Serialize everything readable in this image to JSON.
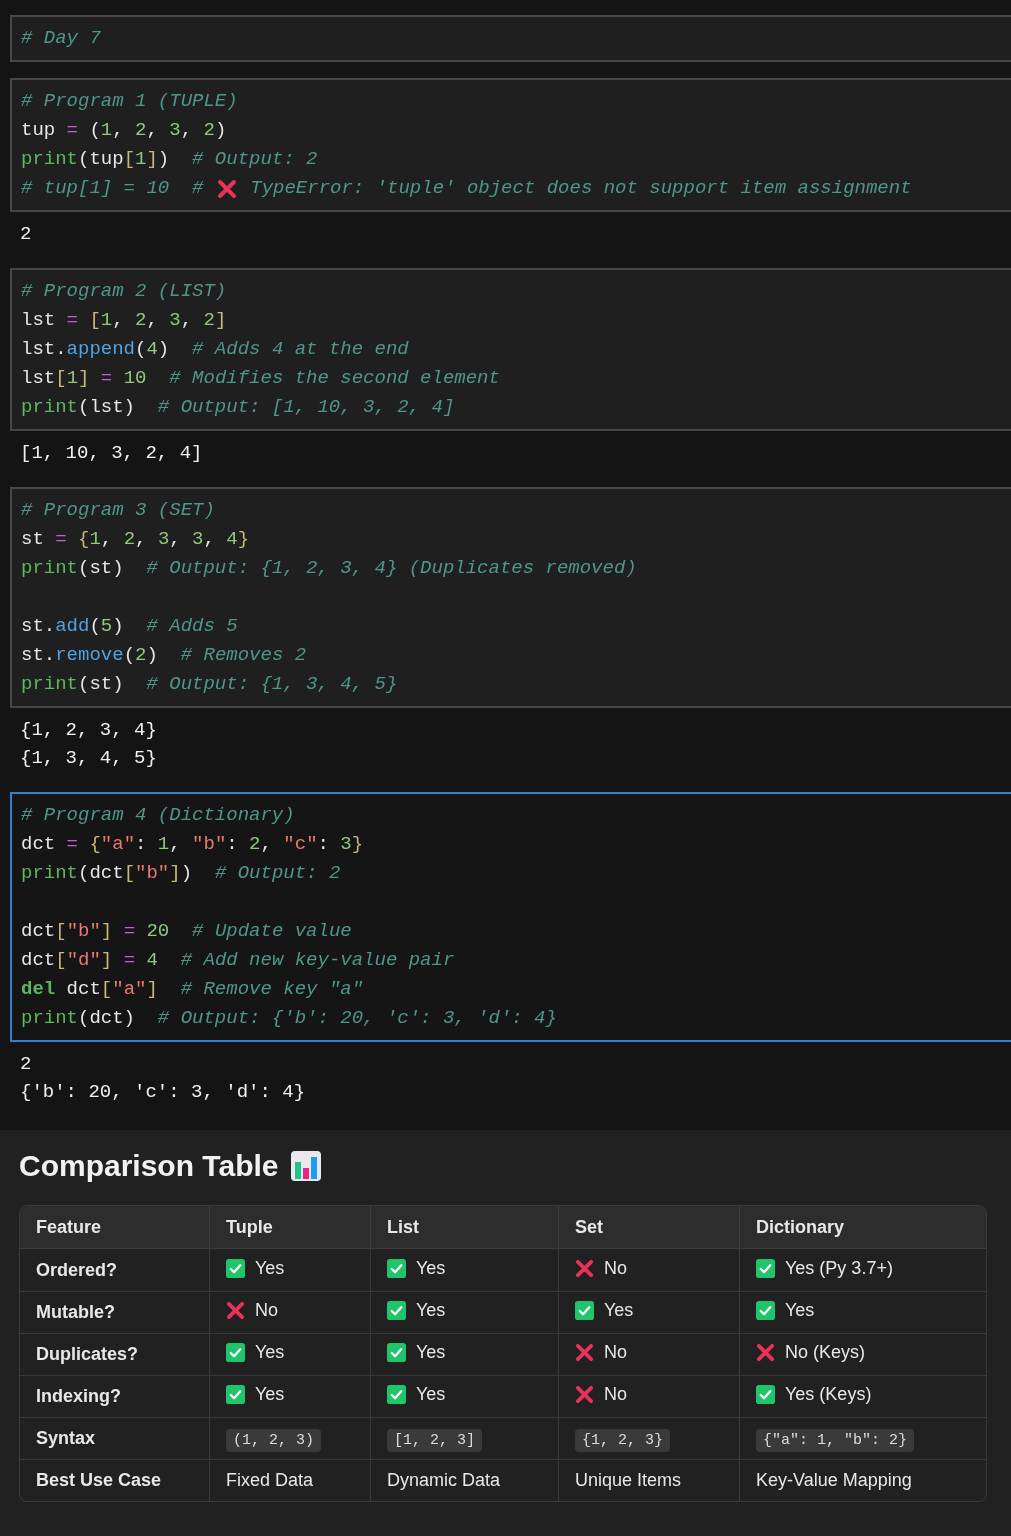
{
  "notebook": {
    "cells": [
      {
        "selected": false,
        "lines": [
          {
            "kind": "code",
            "tokens": [
              {
                "kind": "comment",
                "text": "# Day 7"
              }
            ]
          }
        ]
      },
      {
        "selected": false,
        "lines": [
          {
            "kind": "code",
            "tokens": [
              {
                "kind": "comment",
                "text": "# Program 1 (TUPLE)"
              }
            ]
          },
          {
            "kind": "code",
            "tokens": [
              {
                "kind": "var",
                "text": "tup "
              },
              {
                "kind": "op",
                "text": "="
              },
              {
                "kind": "punct",
                "text": " ("
              },
              {
                "kind": "num",
                "text": "1"
              },
              {
                "kind": "punct",
                "text": ", "
              },
              {
                "kind": "num",
                "text": "2"
              },
              {
                "kind": "punct",
                "text": ", "
              },
              {
                "kind": "num",
                "text": "3"
              },
              {
                "kind": "punct",
                "text": ", "
              },
              {
                "kind": "num",
                "text": "2"
              },
              {
                "kind": "punct",
                "text": ")"
              }
            ]
          },
          {
            "kind": "code",
            "tokens": [
              {
                "kind": "func",
                "text": "print"
              },
              {
                "kind": "punct",
                "text": "(tup"
              },
              {
                "kind": "bracket",
                "text": "["
              },
              {
                "kind": "num",
                "text": "1"
              },
              {
                "kind": "bracket",
                "text": "]"
              },
              {
                "kind": "punct",
                "text": ")  "
              },
              {
                "kind": "comment",
                "text": "# Output: 2"
              }
            ]
          },
          {
            "kind": "code",
            "tokens": [
              {
                "kind": "comment",
                "text": "# tup[1] = 10  # "
              },
              {
                "kind": "cross"
              },
              {
                "kind": "comment",
                "text": " TypeError: 'tuple' object does not support item assignment"
              }
            ]
          }
        ],
        "outputs": [
          "2"
        ]
      },
      {
        "selected": false,
        "lines": [
          {
            "kind": "code",
            "tokens": [
              {
                "kind": "comment",
                "text": "# Program 2 (LIST)"
              }
            ]
          },
          {
            "kind": "code",
            "tokens": [
              {
                "kind": "var",
                "text": "lst "
              },
              {
                "kind": "op",
                "text": "= "
              },
              {
                "kind": "bracket",
                "text": "["
              },
              {
                "kind": "num",
                "text": "1"
              },
              {
                "kind": "punct",
                "text": ", "
              },
              {
                "kind": "num",
                "text": "2"
              },
              {
                "kind": "punct",
                "text": ", "
              },
              {
                "kind": "num",
                "text": "3"
              },
              {
                "kind": "punct",
                "text": ", "
              },
              {
                "kind": "num",
                "text": "2"
              },
              {
                "kind": "bracket",
                "text": "]"
              }
            ]
          },
          {
            "kind": "code",
            "tokens": [
              {
                "kind": "var",
                "text": "lst."
              },
              {
                "kind": "method",
                "text": "append"
              },
              {
                "kind": "punct",
                "text": "("
              },
              {
                "kind": "num",
                "text": "4"
              },
              {
                "kind": "punct",
                "text": ")  "
              },
              {
                "kind": "comment",
                "text": "# Adds 4 at the end"
              }
            ]
          },
          {
            "kind": "code",
            "tokens": [
              {
                "kind": "var",
                "text": "lst"
              },
              {
                "kind": "bracket",
                "text": "["
              },
              {
                "kind": "num",
                "text": "1"
              },
              {
                "kind": "bracket",
                "text": "]"
              },
              {
                "kind": "op",
                "text": " = "
              },
              {
                "kind": "num",
                "text": "10"
              },
              {
                "kind": "comment",
                "text": "  # Modifies the second element"
              }
            ]
          },
          {
            "kind": "code",
            "tokens": [
              {
                "kind": "func",
                "text": "print"
              },
              {
                "kind": "punct",
                "text": "(lst)  "
              },
              {
                "kind": "comment",
                "text": "# Output: [1, 10, 3, 2, 4]"
              }
            ]
          }
        ],
        "outputs": [
          "[1, 10, 3, 2, 4]"
        ]
      },
      {
        "selected": false,
        "lines": [
          {
            "kind": "code",
            "tokens": [
              {
                "kind": "comment",
                "text": "# Program 3 (SET)"
              }
            ]
          },
          {
            "kind": "code",
            "tokens": [
              {
                "kind": "var",
                "text": "st "
              },
              {
                "kind": "op",
                "text": "= "
              },
              {
                "kind": "bracket",
                "text": "{"
              },
              {
                "kind": "num",
                "text": "1"
              },
              {
                "kind": "punct",
                "text": ", "
              },
              {
                "kind": "num",
                "text": "2"
              },
              {
                "kind": "punct",
                "text": ", "
              },
              {
                "kind": "num",
                "text": "3"
              },
              {
                "kind": "punct",
                "text": ", "
              },
              {
                "kind": "num",
                "text": "3"
              },
              {
                "kind": "punct",
                "text": ", "
              },
              {
                "kind": "num",
                "text": "4"
              },
              {
                "kind": "bracket",
                "text": "}"
              }
            ]
          },
          {
            "kind": "code",
            "tokens": [
              {
                "kind": "func",
                "text": "print"
              },
              {
                "kind": "punct",
                "text": "(st)  "
              },
              {
                "kind": "comment",
                "text": "# Output: {1, 2, 3, 4} (Duplicates removed)"
              }
            ]
          },
          {
            "kind": "blank"
          },
          {
            "kind": "code",
            "tokens": [
              {
                "kind": "var",
                "text": "st."
              },
              {
                "kind": "method",
                "text": "add"
              },
              {
                "kind": "punct",
                "text": "("
              },
              {
                "kind": "num",
                "text": "5"
              },
              {
                "kind": "punct",
                "text": ")  "
              },
              {
                "kind": "comment",
                "text": "# Adds 5"
              }
            ]
          },
          {
            "kind": "code",
            "tokens": [
              {
                "kind": "var",
                "text": "st."
              },
              {
                "kind": "method",
                "text": "remove"
              },
              {
                "kind": "punct",
                "text": "("
              },
              {
                "kind": "num",
                "text": "2"
              },
              {
                "kind": "punct",
                "text": ")  "
              },
              {
                "kind": "comment",
                "text": "# Removes 2"
              }
            ]
          },
          {
            "kind": "code",
            "tokens": [
              {
                "kind": "func",
                "text": "print"
              },
              {
                "kind": "punct",
                "text": "(st)  "
              },
              {
                "kind": "comment",
                "text": "# Output: {1, 3, 4, 5}"
              }
            ]
          }
        ],
        "outputs": [
          "{1, 2, 3, 4}",
          "{1, 3, 4, 5}"
        ]
      },
      {
        "selected": true,
        "lines": [
          {
            "kind": "code",
            "tokens": [
              {
                "kind": "comment",
                "text": "# Program 4 (Dictionary)"
              }
            ]
          },
          {
            "kind": "code",
            "tokens": [
              {
                "kind": "var",
                "text": "dct "
              },
              {
                "kind": "op",
                "text": "= "
              },
              {
                "kind": "bracket",
                "text": "{"
              },
              {
                "kind": "str",
                "text": "\"a\""
              },
              {
                "kind": "punct",
                "text": ": "
              },
              {
                "kind": "num",
                "text": "1"
              },
              {
                "kind": "punct",
                "text": ", "
              },
              {
                "kind": "str",
                "text": "\"b\""
              },
              {
                "kind": "punct",
                "text": ": "
              },
              {
                "kind": "num",
                "text": "2"
              },
              {
                "kind": "punct",
                "text": ", "
              },
              {
                "kind": "str",
                "text": "\"c\""
              },
              {
                "kind": "punct",
                "text": ": "
              },
              {
                "kind": "num",
                "text": "3"
              },
              {
                "kind": "bracket",
                "text": "}"
              }
            ]
          },
          {
            "kind": "code",
            "tokens": [
              {
                "kind": "func",
                "text": "print"
              },
              {
                "kind": "punct",
                "text": "(dct"
              },
              {
                "kind": "bracket",
                "text": "["
              },
              {
                "kind": "str",
                "text": "\"b\""
              },
              {
                "kind": "bracket",
                "text": "]"
              },
              {
                "kind": "punct",
                "text": ")  "
              },
              {
                "kind": "comment",
                "text": "# Output: 2"
              }
            ]
          },
          {
            "kind": "blank"
          },
          {
            "kind": "code",
            "tokens": [
              {
                "kind": "var",
                "text": "dct"
              },
              {
                "kind": "bracket",
                "text": "["
              },
              {
                "kind": "str",
                "text": "\"b\""
              },
              {
                "kind": "bracket",
                "text": "]"
              },
              {
                "kind": "op",
                "text": " = "
              },
              {
                "kind": "num",
                "text": "20"
              },
              {
                "kind": "comment",
                "text": "  # Update value"
              }
            ]
          },
          {
            "kind": "code",
            "tokens": [
              {
                "kind": "var",
                "text": "dct"
              },
              {
                "kind": "bracket",
                "text": "["
              },
              {
                "kind": "str",
                "text": "\"d\""
              },
              {
                "kind": "bracket",
                "text": "]"
              },
              {
                "kind": "op",
                "text": " = "
              },
              {
                "kind": "num",
                "text": "4"
              },
              {
                "kind": "comment",
                "text": "  # Add new key-value pair"
              }
            ]
          },
          {
            "kind": "code",
            "tokens": [
              {
                "kind": "keyword",
                "text": "del"
              },
              {
                "kind": "punct",
                "text": " dct"
              },
              {
                "kind": "bracket",
                "text": "["
              },
              {
                "kind": "str",
                "text": "\"a\""
              },
              {
                "kind": "bracket",
                "text": "]"
              },
              {
                "kind": "comment",
                "text": "  # Remove key \"a\""
              }
            ]
          },
          {
            "kind": "code",
            "tokens": [
              {
                "kind": "func",
                "text": "print"
              },
              {
                "kind": "punct",
                "text": "(dct)  "
              },
              {
                "kind": "comment",
                "text": "# Output: {'b': 20, 'c': 3, 'd': 4}"
              }
            ]
          }
        ],
        "outputs": [
          "2",
          "{'b': 20, 'c': 3, 'd': 4}"
        ]
      }
    ]
  },
  "comparison": {
    "title": "Comparison Table",
    "columns": [
      "Feature",
      "Tuple",
      "List",
      "Set",
      "Dictionary"
    ],
    "rows": [
      [
        {
          "kind": "label",
          "text": "Ordered?"
        },
        {
          "kind": "check",
          "text": "Yes"
        },
        {
          "kind": "check",
          "text": "Yes"
        },
        {
          "kind": "cross",
          "text": "No"
        },
        {
          "kind": "check",
          "text": "Yes (Py 3.7+)"
        }
      ],
      [
        {
          "kind": "label",
          "text": "Mutable?"
        },
        {
          "kind": "cross",
          "text": "No"
        },
        {
          "kind": "check",
          "text": "Yes"
        },
        {
          "kind": "check",
          "text": "Yes"
        },
        {
          "kind": "check",
          "text": "Yes"
        }
      ],
      [
        {
          "kind": "label",
          "text": "Duplicates?"
        },
        {
          "kind": "check",
          "text": "Yes"
        },
        {
          "kind": "check",
          "text": "Yes"
        },
        {
          "kind": "cross",
          "text": "No"
        },
        {
          "kind": "cross",
          "text": "No (Keys)"
        }
      ],
      [
        {
          "kind": "label",
          "text": "Indexing?"
        },
        {
          "kind": "check",
          "text": "Yes"
        },
        {
          "kind": "check",
          "text": "Yes"
        },
        {
          "kind": "cross",
          "text": "No"
        },
        {
          "kind": "check",
          "text": "Yes (Keys)"
        }
      ],
      [
        {
          "kind": "label",
          "text": "Syntax"
        },
        {
          "kind": "code",
          "text": "(1, 2, 3)"
        },
        {
          "kind": "code",
          "text": "[1, 2, 3]"
        },
        {
          "kind": "code",
          "text": "{1, 2, 3}"
        },
        {
          "kind": "code",
          "text": "{\"a\": 1, \"b\": 2}"
        }
      ],
      [
        {
          "kind": "label",
          "text": "Best Use Case"
        },
        {
          "kind": "text",
          "text": "Fixed Data"
        },
        {
          "kind": "text",
          "text": "Dynamic Data"
        },
        {
          "kind": "text",
          "text": "Unique Items"
        },
        {
          "kind": "text",
          "text": "Key-Value Mapping"
        }
      ]
    ]
  }
}
